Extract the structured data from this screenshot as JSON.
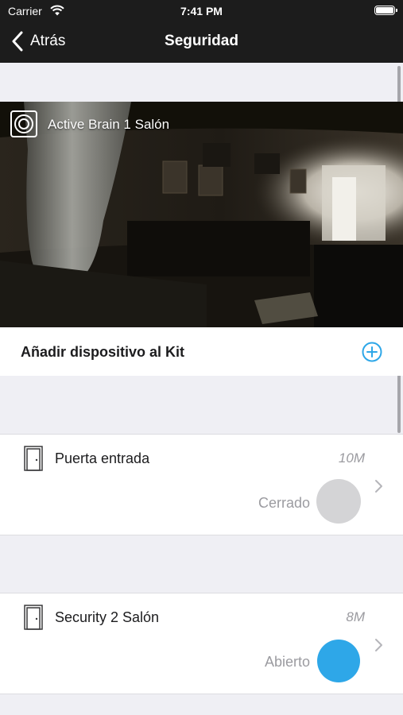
{
  "status_bar": {
    "carrier": "Carrier",
    "time": "7:41 PM"
  },
  "nav": {
    "back_label": "Atrás",
    "title": "Seguridad"
  },
  "camera": {
    "title": "Active Brain 1 Salón"
  },
  "add_device": {
    "label": "Añadir dispositivo al Kit"
  },
  "devices": [
    {
      "name": "Puerta entrada",
      "time": "10M",
      "state": "Cerrado",
      "state_color": "#d4d4d6"
    },
    {
      "name": "Security 2 Salón",
      "time": "8M",
      "state": "Abierto",
      "state_color": "#2ea7e8"
    }
  ],
  "colors": {
    "accent": "#2ea7e8",
    "nav_bg": "#1c1c1c",
    "page_bg": "#efeff4"
  },
  "icons": {
    "back": "chevron-left",
    "camera": "camera-lens",
    "add": "plus-circle",
    "device": "door",
    "row_arrow": "chevron-right"
  }
}
